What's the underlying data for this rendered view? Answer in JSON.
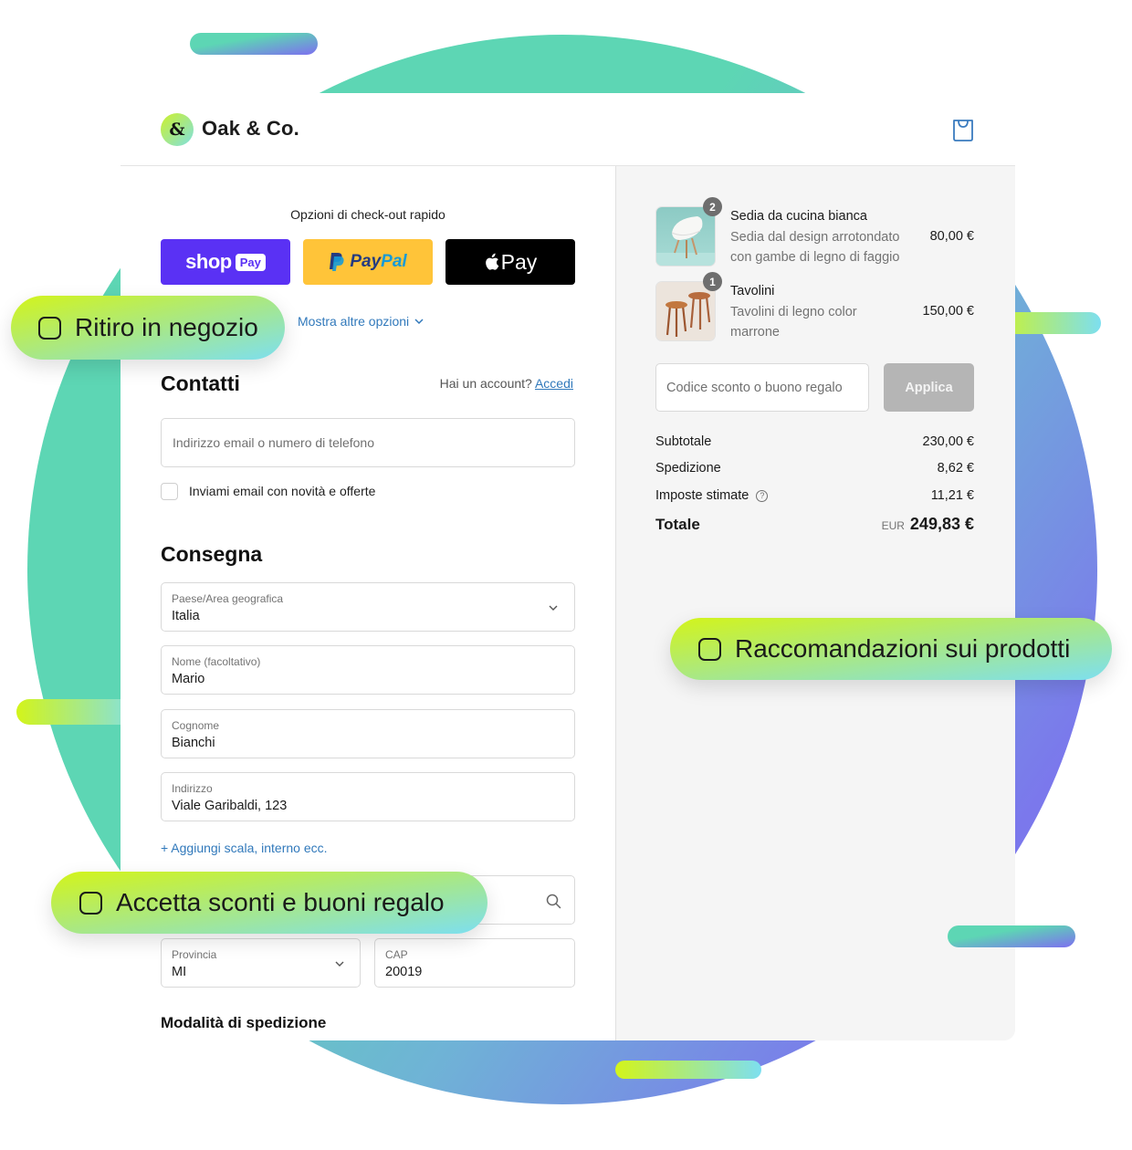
{
  "colors": {
    "teal": "#5dd6b4",
    "purple": "#7d6ff0",
    "lime": "#d3f41a",
    "cyan": "#7ddff0",
    "link": "#3179bb",
    "shop_pay": "#5a31f4",
    "paypal": "#ffc439",
    "apple_pay": "#000000"
  },
  "header": {
    "logo_glyph": "&",
    "brand": "Oak & Co.",
    "cart_icon": "shopping-bag-icon"
  },
  "express": {
    "title": "Opzioni di check-out rapido",
    "shop_pay": {
      "word": "shop",
      "badge": "Pay"
    },
    "paypal": {
      "part_a": "Pay",
      "part_b": "Pal"
    },
    "apple_pay": {
      "word": "Pay"
    },
    "more_options": "Mostra altre opzioni"
  },
  "contact": {
    "title": "Contatti",
    "account_prompt": "Hai un account?",
    "login_link": "Accedi",
    "email_placeholder": "Indirizzo email o numero di telefono",
    "newsletter_label": "Inviami email con novità e offerte",
    "newsletter_checked": false
  },
  "delivery": {
    "title": "Consegna",
    "country": {
      "label": "Paese/Area geografica",
      "value": "Italia"
    },
    "first_name": {
      "label": "Nome (facoltativo)",
      "value": "Mario"
    },
    "last_name": {
      "label": "Cognome",
      "value": "Bianchi"
    },
    "address": {
      "label": "Indirizzo",
      "value": "Viale Garibaldi, 123"
    },
    "add_line": "+ Aggiungi scala, interno ecc.",
    "city": {
      "value": ""
    },
    "province": {
      "label": "Provincia",
      "value": "MI"
    },
    "zip": {
      "label": "CAP",
      "value": "20019"
    },
    "shipping_method_title": "Modalità di spedizione"
  },
  "order": {
    "items": [
      {
        "quantity": "2",
        "title": "Sedia da cucina bianca",
        "description_lines": [
          "Sedia dal design arrotondato",
          "con gambe di legno di faggio"
        ],
        "price": "80,00 €"
      },
      {
        "quantity": "1",
        "title": "Tavolini",
        "description_lines": [
          "Tavolini di legno color",
          "marrone"
        ],
        "price": "150,00 €"
      }
    ],
    "discount_placeholder": "Codice sconto o buono regalo",
    "apply_label": "Applica",
    "subtotal": {
      "label": "Subtotale",
      "value": "230,00 €"
    },
    "shipping": {
      "label": "Spedizione",
      "value": "8,62 €"
    },
    "taxes": {
      "label": "Imposte stimate",
      "value": "11,21 €",
      "help_glyph": "?"
    },
    "total": {
      "label": "Totale",
      "currency": "EUR",
      "value": "249,83 €"
    }
  },
  "feature_pills": [
    {
      "label": "Ritiro in negozio"
    },
    {
      "label": "Raccomandazioni sui prodotti"
    },
    {
      "label": "Accetta sconti e buoni regalo"
    }
  ]
}
